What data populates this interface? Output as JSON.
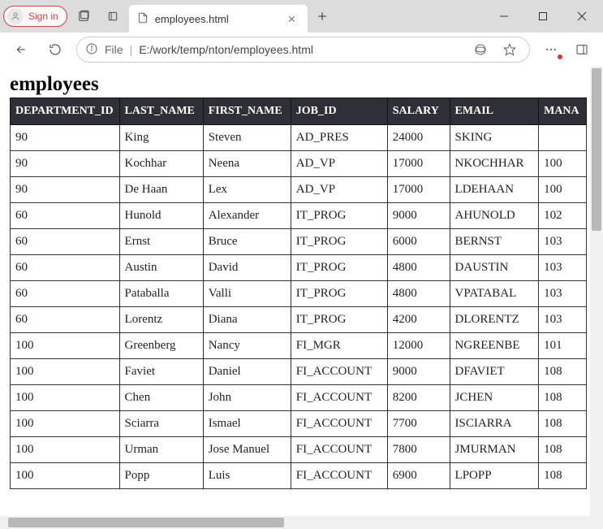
{
  "titlebar": {
    "signin_label": "Sign in",
    "tab_title": "employees.html"
  },
  "toolbar": {
    "file_label": "File",
    "url": "E:/work/temp/nton/employees.html"
  },
  "page": {
    "title": "employees"
  },
  "table": {
    "headers": [
      "DEPARTMENT_ID",
      "LAST_NAME",
      "FIRST_NAME",
      "JOB_ID",
      "SALARY",
      "EMAIL",
      "MANA"
    ],
    "rows": [
      [
        "90",
        "King",
        "Steven",
        "AD_PRES",
        "24000",
        "SKING",
        ""
      ],
      [
        "90",
        "Kochhar",
        "Neena",
        "AD_VP",
        "17000",
        "NKOCHHAR",
        "100"
      ],
      [
        "90",
        "De Haan",
        "Lex",
        "AD_VP",
        "17000",
        "LDEHAAN",
        "100"
      ],
      [
        "60",
        "Hunold",
        "Alexander",
        "IT_PROG",
        "9000",
        "AHUNOLD",
        "102"
      ],
      [
        "60",
        "Ernst",
        "Bruce",
        "IT_PROG",
        "6000",
        "BERNST",
        "103"
      ],
      [
        "60",
        "Austin",
        "David",
        "IT_PROG",
        "4800",
        "DAUSTIN",
        "103"
      ],
      [
        "60",
        "Pataballa",
        "Valli",
        "IT_PROG",
        "4800",
        "VPATABAL",
        "103"
      ],
      [
        "60",
        "Lorentz",
        "Diana",
        "IT_PROG",
        "4200",
        "DLORENTZ",
        "103"
      ],
      [
        "100",
        "Greenberg",
        "Nancy",
        "FI_MGR",
        "12000",
        "NGREENBE",
        "101"
      ],
      [
        "100",
        "Faviet",
        "Daniel",
        "FI_ACCOUNT",
        "9000",
        "DFAVIET",
        "108"
      ],
      [
        "100",
        "Chen",
        "John",
        "FI_ACCOUNT",
        "8200",
        "JCHEN",
        "108"
      ],
      [
        "100",
        "Sciarra",
        "Ismael",
        "FI_ACCOUNT",
        "7700",
        "ISCIARRA",
        "108"
      ],
      [
        "100",
        "Urman",
        "Jose Manuel",
        "FI_ACCOUNT",
        "7800",
        "JMURMAN",
        "108"
      ],
      [
        "100",
        "Popp",
        "Luis",
        "FI_ACCOUNT",
        "6900",
        "LPOPP",
        "108"
      ]
    ]
  }
}
